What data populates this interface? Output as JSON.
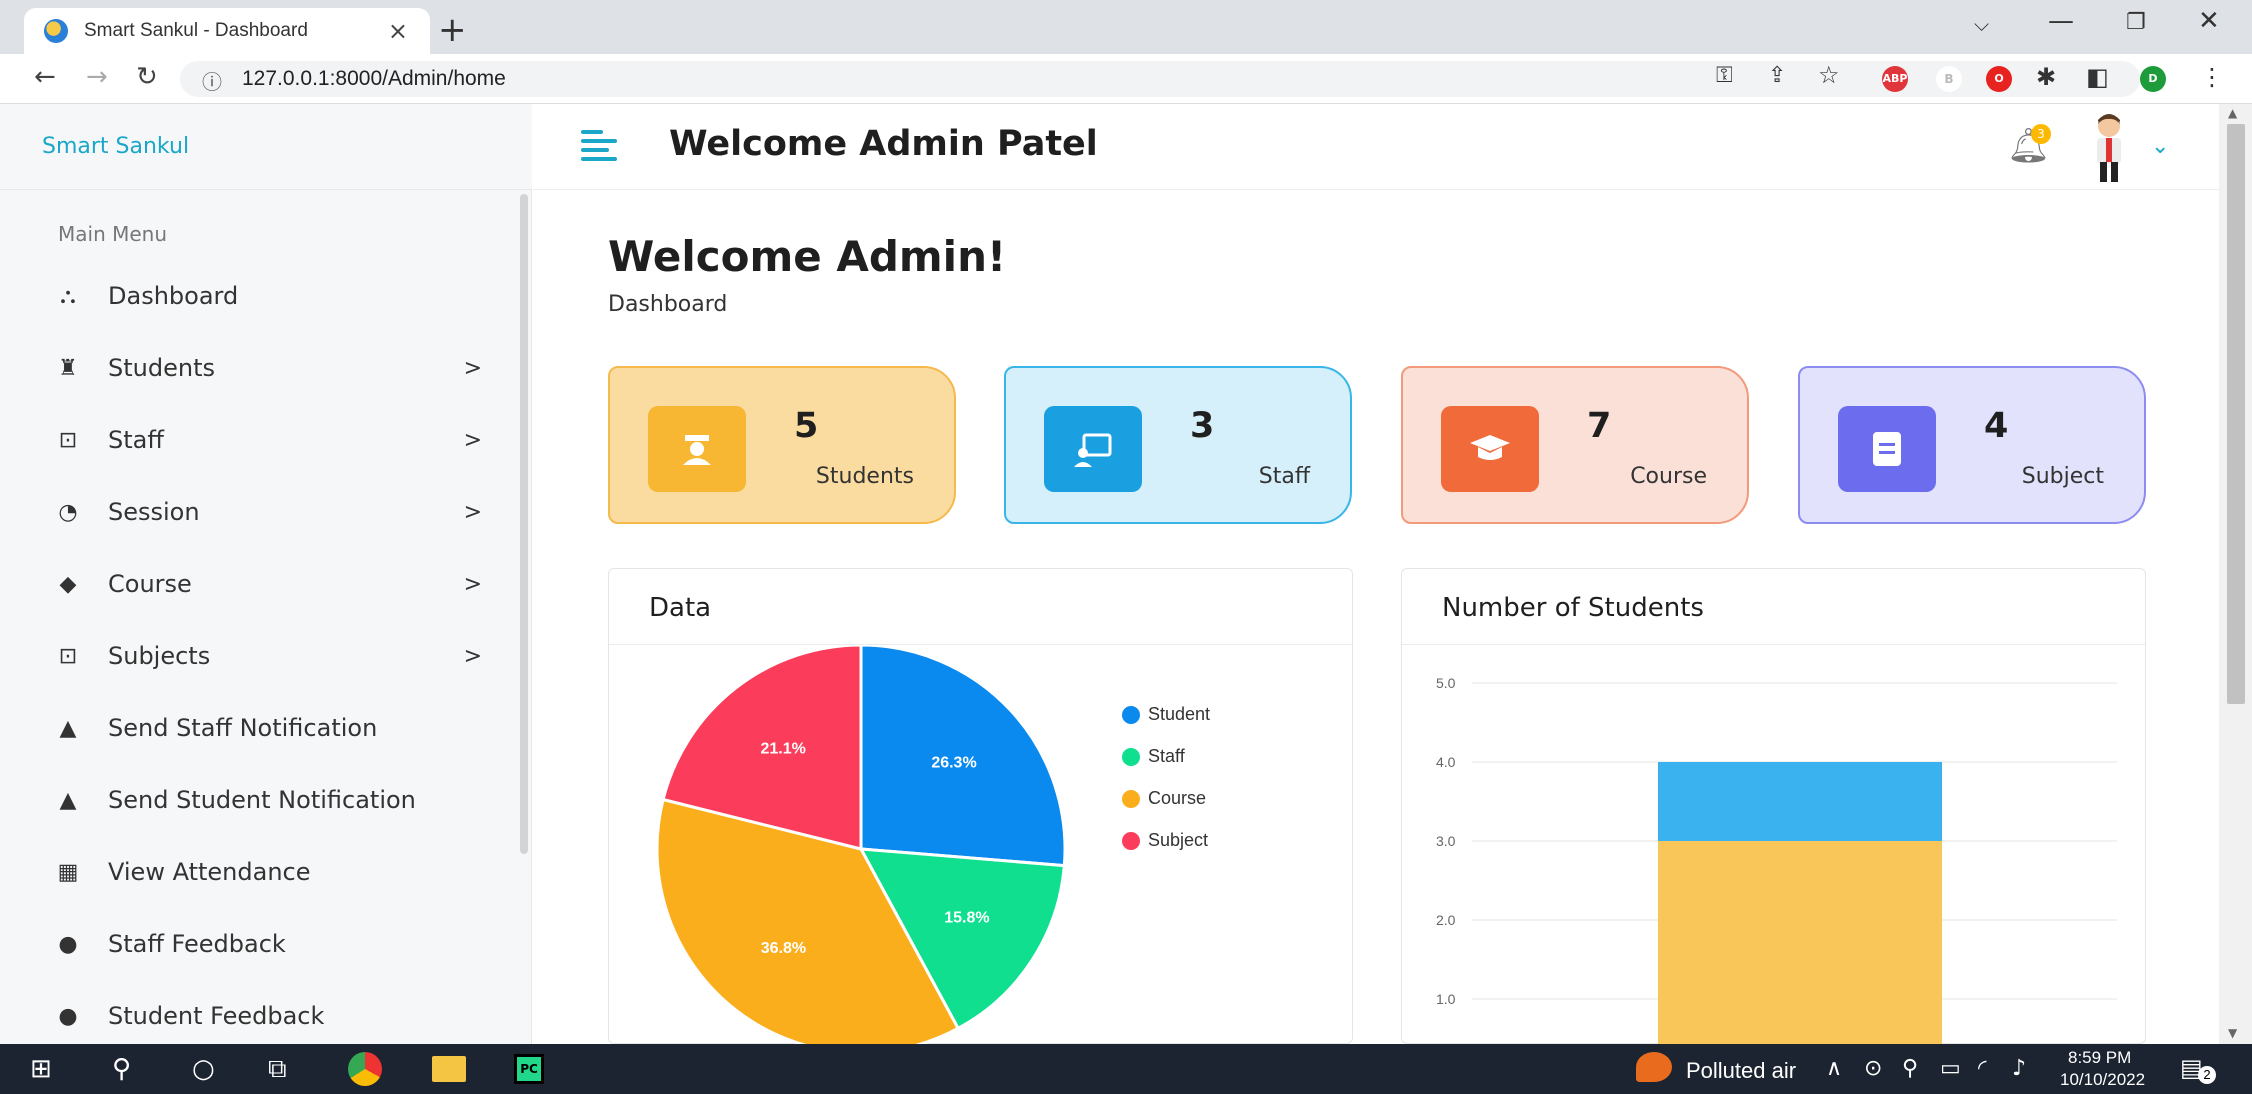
{
  "browser": {
    "tab_title": "Smart Sankul - Dashboard",
    "tab_close": "×",
    "new_tab": "+",
    "url": "127.0.0.1:8000/Admin/home",
    "ext_abp": "ABP",
    "profile_initial": "D"
  },
  "sidebar": {
    "brand": "Smart Sankul",
    "heading": "Main Menu",
    "items": [
      {
        "label": "Dashboard",
        "icon": "dashboard-icon",
        "has_submenu": false
      },
      {
        "label": "Students",
        "icon": "student-icon",
        "has_submenu": true
      },
      {
        "label": "Staff",
        "icon": "staff-icon",
        "has_submenu": true
      },
      {
        "label": "Session",
        "icon": "clock-icon",
        "has_submenu": true
      },
      {
        "label": "Course",
        "icon": "graduation-cap-icon",
        "has_submenu": true
      },
      {
        "label": "Subjects",
        "icon": "subjects-icon",
        "has_submenu": true
      },
      {
        "label": "Send Staff Notification",
        "icon": "bell-icon",
        "has_submenu": false
      },
      {
        "label": "Send Student Notification",
        "icon": "bell-icon",
        "has_submenu": false
      },
      {
        "label": "View Attendance",
        "icon": "calendar-icon",
        "has_submenu": false
      },
      {
        "label": "Staff Feedback",
        "icon": "comments-icon",
        "has_submenu": false
      },
      {
        "label": "Student Feedback",
        "icon": "comments-icon",
        "has_submenu": false
      }
    ],
    "arrow": ">"
  },
  "header": {
    "welcome": "Welcome  Admin Patel",
    "notification_count": "3"
  },
  "main": {
    "title": "Welcome Admin!",
    "breadcrumb": "Dashboard",
    "stats": [
      {
        "value": "5",
        "label": "Students",
        "bg": "#fbdca0",
        "border": "#f5b94e",
        "icon_bg": "#f7b733",
        "icon": "student-icon"
      },
      {
        "value": "3",
        "label": "Staff",
        "bg": "#d5effb",
        "border": "#38b6e8",
        "icon_bg": "#1aa0e0",
        "icon": "staff-icon"
      },
      {
        "value": "7",
        "label": "Course",
        "bg": "#fbe0d8",
        "border": "#f29a7b",
        "icon_bg": "#f06a3a",
        "icon": "graduation-cap-icon"
      },
      {
        "value": "4",
        "label": "Subject",
        "bg": "#e2e2fc",
        "border": "#8c8cf0",
        "icon_bg": "#6c6cee",
        "icon": "book-icon"
      }
    ],
    "pie_panel_title": "Data",
    "bar_panel_title": "Number of Students"
  },
  "chart_data": [
    {
      "type": "pie",
      "title": "",
      "categories": [
        "Student",
        "Staff",
        "Course",
        "Subject"
      ],
      "values": [
        26.3,
        15.8,
        36.8,
        21.1
      ],
      "labels": [
        "26.3%",
        "15.8%",
        "36.8%",
        "21.1%"
      ],
      "colors": [
        "#0a8aef",
        "#0fdf8f",
        "#fbae1c",
        "#fb3d5b"
      ],
      "legend_position": "right"
    },
    {
      "type": "bar",
      "title": "",
      "stacked": true,
      "y_ticks": [
        "5.0",
        "4.0",
        "3.0",
        "2.0",
        "1.0"
      ],
      "ylim": [
        0,
        5
      ],
      "series": [
        {
          "values": [
            3
          ],
          "color": "#f9c65a"
        },
        {
          "values": [
            1
          ],
          "color": "#3ab2f0"
        }
      ],
      "grid": true
    }
  ],
  "taskbar": {
    "weather": "Polluted air",
    "time": "8:59 PM",
    "date": "10/10/2022",
    "notif_count": "2"
  }
}
